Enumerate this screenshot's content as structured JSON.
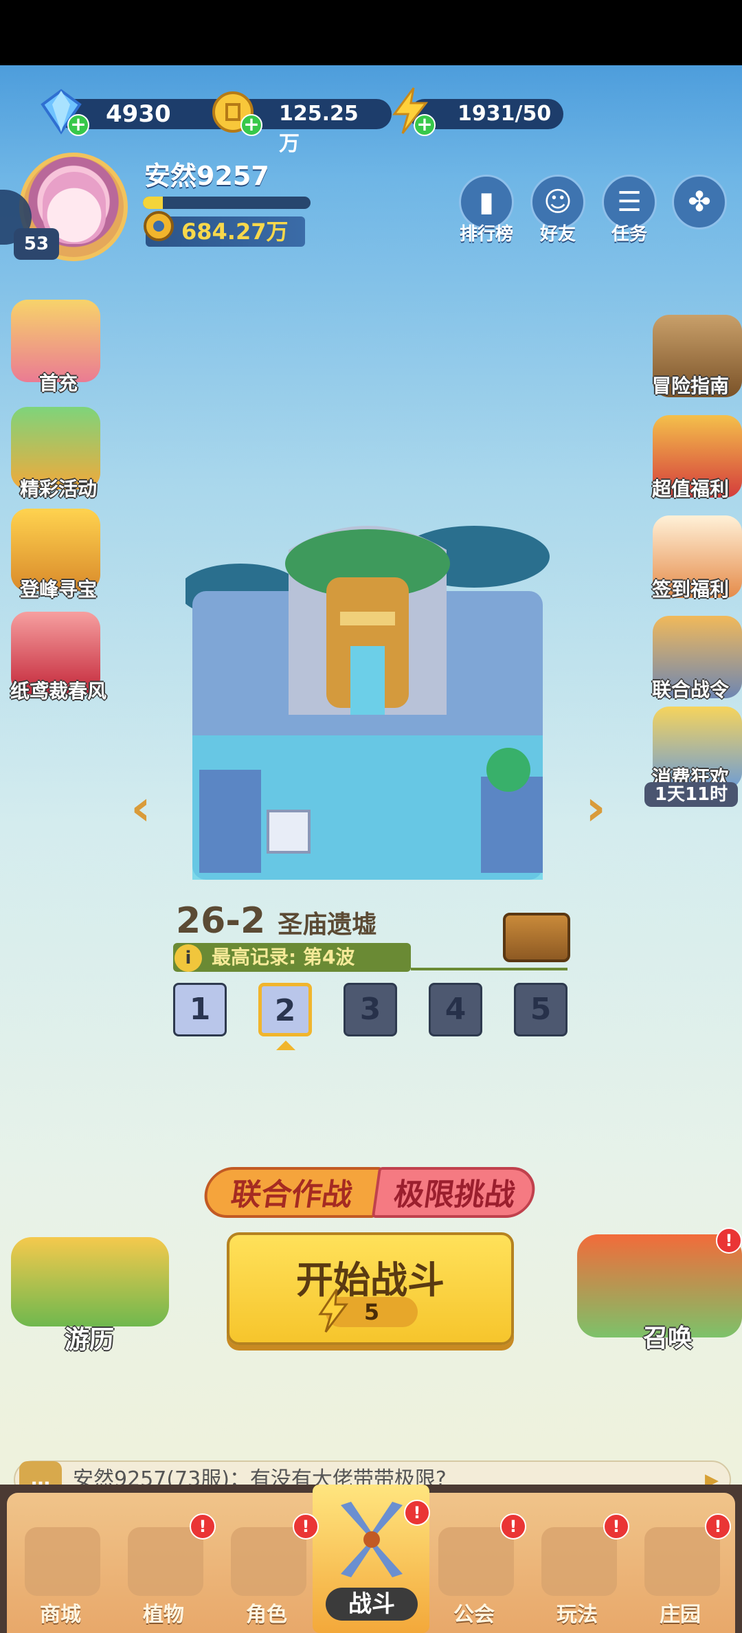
{
  "currencies": {
    "gems": "4930",
    "gold": "125.25万",
    "energy": "1931/50"
  },
  "player": {
    "name": "安然9257",
    "level": "53",
    "power": "684.27万",
    "xp_progress": 0.12
  },
  "top_buttons": {
    "rank": "排行榜",
    "friends": "好友",
    "tasks": "任务"
  },
  "left_menu": {
    "first_charge": "首充",
    "events": "精彩活动",
    "treasure": "登峰寻宝",
    "kite": "纸鸢裁春风"
  },
  "right_menu": {
    "guide": "冒险指南",
    "welfare": "超值福利",
    "signin": "签到福利",
    "battle_pass": "联合战令",
    "spend": "消费狂欢",
    "spend_timer": "1天11时"
  },
  "stage": {
    "number": "26-2",
    "name": "圣庙遗墟",
    "record": "最高记录: 第4波",
    "levels": [
      "1",
      "2",
      "3",
      "4",
      "5"
    ],
    "current_level": "2"
  },
  "modes": {
    "coop": "联合作战",
    "limit": "极限挑战"
  },
  "start": {
    "label": "开始战斗",
    "cost": "5"
  },
  "side_actions": {
    "travel": "游历",
    "summon": "召唤"
  },
  "chat": {
    "message": "安然9257(73服)：有没有大佬带带极限?"
  },
  "nav": {
    "shop": "商城",
    "plants": "植物",
    "roles": "角色",
    "battle": "战斗",
    "guild": "公会",
    "play": "玩法",
    "manor": "庄园"
  },
  "badge_symbol": "!",
  "colors": {
    "accent": "#f6c52c",
    "badge": "#ea3535"
  }
}
